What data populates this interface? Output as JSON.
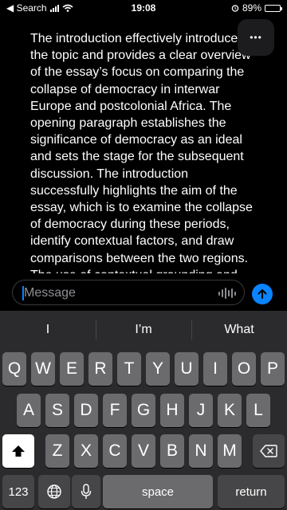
{
  "status_bar": {
    "back_label": "◀ Search",
    "time": "19:08",
    "battery": "89%",
    "battery_level": 0.89
  },
  "content": {
    "text": "The introduction effectively introduces\nthe topic and provides a clear overview\nof the essay’s focus on comparing the\ncollapse of democracy in interwar\nEurope and postcolonial Africa. The\nopening paragraph establishes the\nsignificance of democracy as an ideal\nand sets the stage for the subsequent\ndiscussion. The introduction\nsuccessfully highlights the aim of the\nessay, which is to examine the collapse\nof democracy during these periods,\nidentify contextual factors, and draw\ncomparisons between the two regions.\nThe use of contextual grounding and"
  },
  "more_button": {
    "icon": "ellipsis-icon",
    "label": "•••"
  },
  "composer": {
    "placeholder": "Message",
    "send_icon": "arrow-up-icon",
    "voice_icon": "waveform-icon"
  },
  "keyboard": {
    "suggestions": [
      "I",
      "I’m",
      "What"
    ],
    "row1": [
      "Q",
      "W",
      "E",
      "R",
      "T",
      "Y",
      "U",
      "I",
      "O",
      "P"
    ],
    "row2": [
      "A",
      "S",
      "D",
      "F",
      "G",
      "H",
      "J",
      "K",
      "L"
    ],
    "row3": [
      "Z",
      "X",
      "C",
      "V",
      "B",
      "N",
      "M"
    ],
    "numbers_key": "123",
    "space_key": "space",
    "return_key": "return"
  },
  "colors": {
    "accent": "#0a84ff",
    "keyboard_bg": "#2b2b2d",
    "key": "#6b6b6e",
    "key_dark": "#464648"
  }
}
